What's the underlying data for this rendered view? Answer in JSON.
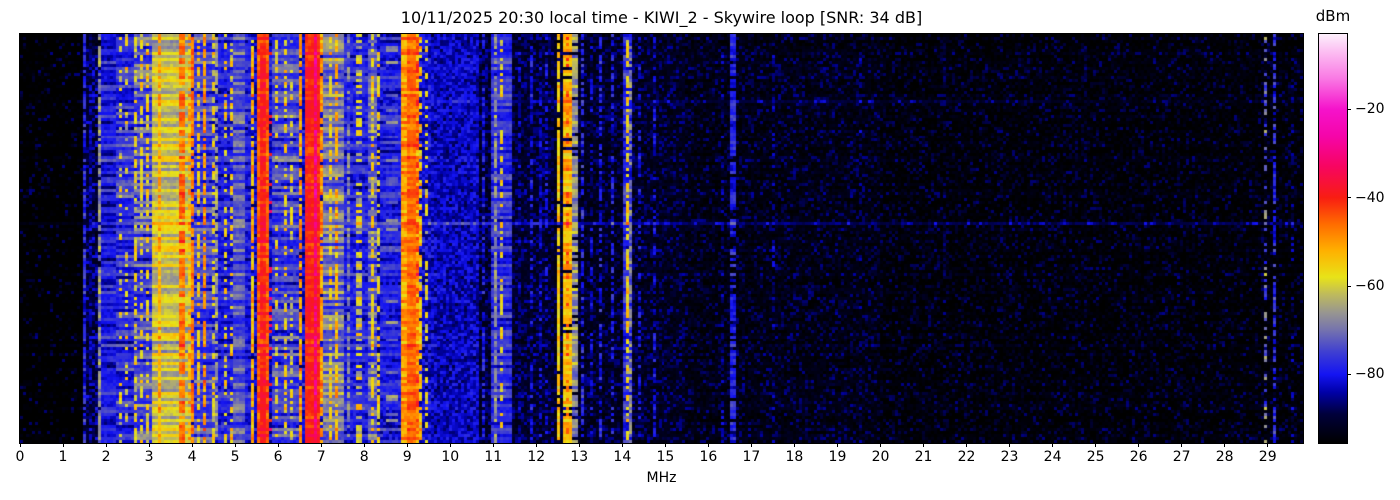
{
  "title": "10/11/2025 20:30 local time - KIWI_2 - Skywire loop [SNR: 34 dB]",
  "xlabel": "MHz",
  "x_axis": {
    "tick_values": [
      0,
      1,
      2,
      3,
      4,
      5,
      6,
      7,
      8,
      9,
      10,
      11,
      12,
      13,
      14,
      15,
      16,
      17,
      18,
      19,
      20,
      21,
      22,
      23,
      24,
      25,
      26,
      27,
      28,
      29
    ],
    "range": [
      0,
      29.82
    ]
  },
  "colorbar": {
    "label": "dBm",
    "tick_values": [
      -20,
      -40,
      -60,
      -80
    ],
    "tick_labels": [
      "−20",
      "−40",
      "−60",
      "−80"
    ],
    "range": [
      -95.5,
      -3
    ]
  },
  "chart_data": {
    "type": "heatmap",
    "title": "10/11/2025 20:30 local time - KIWI_2 - Skywire loop [SNR: 34 dB]",
    "station": "KIWI_2",
    "antenna": "Skywire loop",
    "snr_db": 34,
    "timestamp_label": "10/11/2025 20:30 local time",
    "xlabel": "MHz",
    "x_range": [
      0,
      29.82
    ],
    "value_unit": "dBm",
    "value_range": [
      -95.5,
      -3
    ],
    "colorbar_ticks": [
      -20,
      -40,
      -60,
      -80
    ],
    "colormap": [
      [
        -95.5,
        "#000000"
      ],
      [
        -89,
        "#00003a"
      ],
      [
        -84,
        "#0000a8"
      ],
      [
        -80,
        "#1414f2"
      ],
      [
        -75,
        "#3e3ed2"
      ],
      [
        -70,
        "#7472ae"
      ],
      [
        -66,
        "#989690"
      ],
      [
        -62,
        "#bdb95e"
      ],
      [
        -58,
        "#e8e318"
      ],
      [
        -52,
        "#ffb000"
      ],
      [
        -46,
        "#ff6c00"
      ],
      [
        -40,
        "#f81d12"
      ],
      [
        -33,
        "#f70560"
      ],
      [
        -26,
        "#f505aa"
      ],
      [
        -20,
        "#f513cb"
      ],
      [
        -13,
        "#f97ae4"
      ],
      [
        -7,
        "#fcbef2"
      ],
      [
        -3,
        "#fdf0fc"
      ]
    ],
    "noise_regions_fields": [
      "f0_mhz",
      "f1_mhz",
      "floor_dbm",
      "speckle_prob",
      "speckle_dbm",
      "speckle_var_db"
    ],
    "noise_regions": [
      [
        0,
        1.44,
        -96,
        0.1,
        -90,
        4
      ],
      [
        1.44,
        2.62,
        -91,
        0.45,
        -85,
        5
      ],
      [
        2.62,
        9.55,
        -85,
        0.8,
        -81,
        5
      ],
      [
        9.55,
        10.65,
        -87,
        0.85,
        -82,
        4
      ],
      [
        10.65,
        12.42,
        -92,
        0.5,
        -87,
        4
      ],
      [
        12.42,
        15.5,
        -93,
        0.42,
        -88,
        4
      ],
      [
        15.5,
        20,
        -94,
        0.33,
        -89,
        4
      ],
      [
        20,
        25,
        -95,
        0.28,
        -90,
        4
      ],
      [
        25,
        29.82,
        -95,
        0.25,
        -90,
        4
      ]
    ],
    "bands_fields": [
      "f0_mhz",
      "f1_mhz",
      "level_dbm",
      "variation_db",
      "duty"
    ],
    "bands": [
      [
        1.44,
        1.5,
        -78,
        6,
        0.85
      ],
      [
        1.62,
        1.66,
        -85,
        4,
        0.6
      ],
      [
        1.83,
        1.88,
        -67,
        5,
        0.85
      ],
      [
        1.88,
        2.26,
        -80,
        6,
        1
      ],
      [
        2.13,
        2.18,
        -68,
        5,
        0.85
      ],
      [
        2.26,
        2.62,
        -78,
        7,
        1
      ],
      [
        2.3,
        2.35,
        -59,
        5,
        0.3
      ],
      [
        2.46,
        2.51,
        -60,
        7,
        0.35
      ],
      [
        2.62,
        3.06,
        -74,
        9,
        1
      ],
      [
        2.65,
        2.7,
        -58,
        5,
        0.55
      ],
      [
        2.8,
        2.85,
        -57,
        5,
        0.5
      ],
      [
        2.95,
        3.0,
        -56,
        5,
        0.55
      ],
      [
        3.06,
        3.96,
        -61,
        6,
        1
      ],
      [
        3.18,
        3.25,
        -52,
        5,
        0.8
      ],
      [
        3.31,
        3.37,
        -48,
        4,
        0.8
      ],
      [
        3.52,
        3.58,
        -50,
        5,
        0.7
      ],
      [
        3.72,
        3.8,
        -46,
        4,
        0.85
      ],
      [
        3.88,
        3.94,
        -52,
        5,
        0.65
      ],
      [
        3.96,
        4.03,
        -47,
        4,
        0.9
      ],
      [
        4.03,
        4.56,
        -76,
        8,
        1
      ],
      [
        4.1,
        4.16,
        -56,
        5,
        0.6
      ],
      [
        4.28,
        4.35,
        -50,
        5,
        0.7
      ],
      [
        4.44,
        4.5,
        -58,
        5,
        0.5
      ],
      [
        4.52,
        4.58,
        -66,
        5,
        0.8
      ],
      [
        4.58,
        5.34,
        -80,
        6,
        1
      ],
      [
        4.72,
        4.78,
        -58,
        5,
        0.35
      ],
      [
        4.88,
        4.94,
        -57,
        5,
        0.4
      ],
      [
        4.96,
        5.22,
        -73,
        7,
        1
      ],
      [
        5.06,
        5.12,
        -58,
        5,
        0.35
      ],
      [
        5.35,
        5.43,
        -52,
        5,
        0.8
      ],
      [
        5.48,
        5.79,
        -44,
        4,
        1
      ],
      [
        5.56,
        5.69,
        -40,
        3,
        1
      ],
      [
        5.8,
        5.87,
        -36,
        6,
        0.25
      ],
      [
        5.87,
        6.46,
        -76,
        8,
        1
      ],
      [
        5.95,
        6.01,
        -58,
        5,
        0.4
      ],
      [
        6.12,
        6.18,
        -56,
        5,
        0.45
      ],
      [
        6.3,
        6.36,
        -60,
        5,
        0.4
      ],
      [
        6.48,
        6.58,
        -50,
        5,
        0.8
      ],
      [
        6.62,
        6.99,
        -40,
        3,
        1
      ],
      [
        6.8,
        6.93,
        -34,
        3,
        1
      ],
      [
        6.84,
        6.9,
        -29,
        3,
        0.5
      ],
      [
        6.99,
        7.07,
        -50,
        4,
        0.9
      ],
      [
        7.07,
        7.5,
        -70,
        9,
        1
      ],
      [
        7.18,
        7.25,
        -56,
        5,
        0.6
      ],
      [
        7.34,
        7.42,
        -52,
        5,
        0.7
      ],
      [
        7.5,
        8.09,
        -80,
        6,
        1
      ],
      [
        7.58,
        7.64,
        -68,
        5,
        0.7
      ],
      [
        7.8,
        7.92,
        -60,
        6,
        0.55
      ],
      [
        8.09,
        8.31,
        -72,
        7,
        1
      ],
      [
        8.13,
        8.19,
        -57,
        5,
        0.6
      ],
      [
        8.3,
        8.37,
        -57,
        4,
        0.5
      ],
      [
        8.37,
        8.88,
        -80,
        6,
        1
      ],
      [
        8.5,
        8.78,
        -71,
        6,
        0.22
      ],
      [
        8.86,
        9.26,
        -50,
        5,
        1
      ],
      [
        9.0,
        9.17,
        -46,
        3,
        1
      ],
      [
        9.18,
        9.24,
        -43,
        4,
        0.5
      ],
      [
        9.28,
        9.35,
        -54,
        5,
        0.6
      ],
      [
        9.4,
        9.47,
        -58,
        5,
        0.45
      ],
      [
        9.52,
        9.58,
        -60,
        5,
        0.4
      ],
      [
        10.72,
        10.78,
        -80,
        5,
        0.6
      ],
      [
        10.92,
        11.42,
        -78,
        6,
        1
      ],
      [
        11.02,
        11.09,
        -66,
        5,
        0.7
      ],
      [
        11.12,
        11.2,
        -57,
        5,
        0.45
      ],
      [
        11.6,
        11.66,
        -85,
        4,
        0.5
      ],
      [
        11.86,
        11.93,
        -81,
        5,
        0.55
      ],
      [
        12.06,
        12.12,
        -83,
        4,
        0.5
      ],
      [
        12.2,
        12.26,
        -81,
        4,
        0.45
      ],
      [
        12.46,
        12.53,
        -55,
        4,
        0.9
      ],
      [
        12.62,
        12.79,
        -53,
        5,
        0.9
      ],
      [
        12.66,
        12.74,
        -45,
        4,
        0.3
      ],
      [
        12.82,
        12.95,
        -67,
        7,
        0.85
      ],
      [
        13.04,
        13.11,
        -79,
        5,
        0.65
      ],
      [
        13.27,
        13.33,
        -83,
        4,
        0.45
      ],
      [
        13.46,
        13.54,
        -79,
        5,
        0.55
      ],
      [
        13.72,
        13.8,
        -80,
        5,
        0.55
      ],
      [
        14.0,
        14.24,
        -78,
        6,
        1
      ],
      [
        14.06,
        14.12,
        -56,
        5,
        0.7
      ],
      [
        14.14,
        14.19,
        -68,
        5,
        0.55
      ],
      [
        14.38,
        14.44,
        -81,
        4,
        0.45
      ],
      [
        14.68,
        14.76,
        -81,
        4,
        0.5
      ],
      [
        15.02,
        15.08,
        -85,
        4,
        0.35
      ],
      [
        16.28,
        16.34,
        -85,
        4,
        0.4
      ],
      [
        16.52,
        16.65,
        -79,
        5,
        0.75
      ],
      [
        17.52,
        17.58,
        -85,
        4,
        0.35
      ],
      [
        19.54,
        19.6,
        -86,
        4,
        0.3
      ],
      [
        21.44,
        21.5,
        -88,
        3,
        0.25
      ],
      [
        24.84,
        24.9,
        -87,
        3,
        0.28
      ],
      [
        26.9,
        26.96,
        -88,
        3,
        0.2
      ],
      [
        28.9,
        28.96,
        -71,
        9,
        0.5
      ],
      [
        29.12,
        29.18,
        -78,
        6,
        0.75
      ],
      [
        29.55,
        29.61,
        -86,
        4,
        0.3
      ]
    ],
    "row_streaks": [
      {
        "y_frac": 0.161,
        "segments": [
          [
            9.5,
            24,
            5
          ],
          [
            0,
            9.5,
            1.5
          ],
          [
            24,
            29.82,
            2.5
          ]
        ]
      },
      {
        "y_frac": 0.457,
        "segments": [
          [
            9.5,
            15.3,
            8
          ],
          [
            15.3,
            29.82,
            6
          ],
          [
            0,
            9.5,
            2
          ]
        ]
      }
    ],
    "render": {
      "cols": 428,
      "rows": 137,
      "seed": 1234,
      "row_jitter_db": 2.6,
      "busy_range": [
        1.7,
        9.65
      ]
    }
  }
}
